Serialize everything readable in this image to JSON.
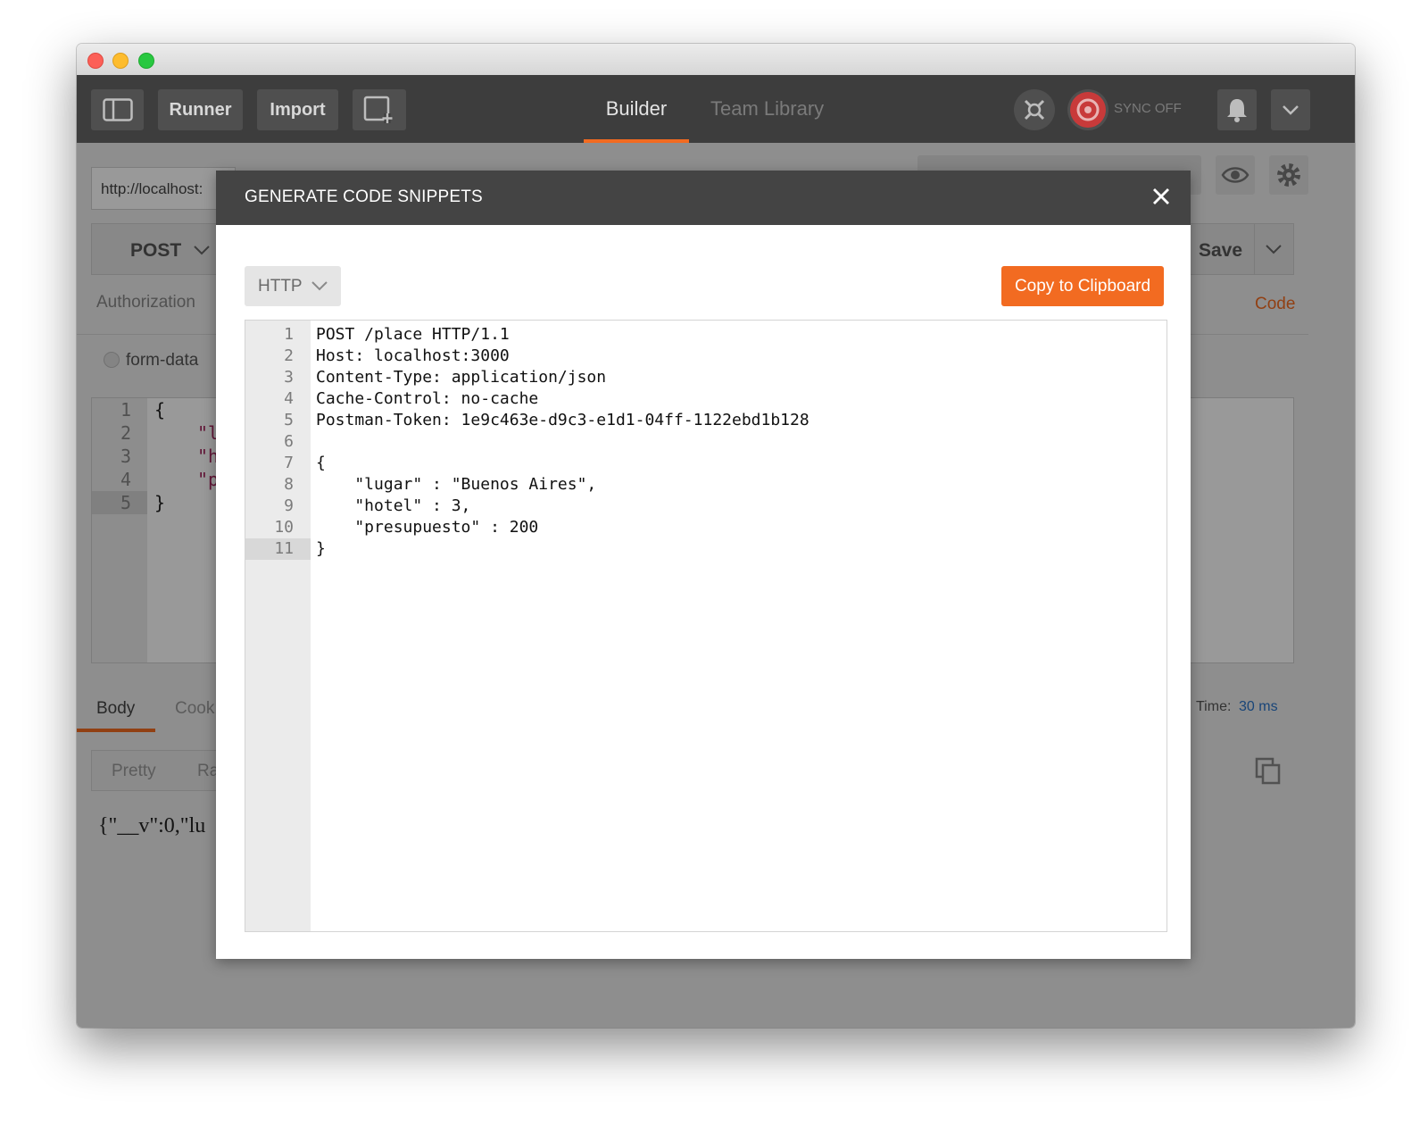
{
  "toolbar": {
    "runner_label": "Runner",
    "import_label": "Import",
    "tab_builder": "Builder",
    "tab_team_library": "Team Library",
    "sync_label": "SYNC OFF"
  },
  "request": {
    "url": "http://localhost:",
    "method": "POST",
    "save_label": "Save",
    "authorization_tab": "Authorization",
    "code_link": "Code",
    "body_option": "form-data"
  },
  "editor_bg": {
    "lines": [
      "1",
      "2",
      "3",
      "4",
      "5"
    ],
    "line1": "{",
    "line2": "\"l",
    "line3": "\"h",
    "line4": "\"p",
    "line5": "}"
  },
  "response": {
    "body_tab": "Body",
    "cookies_tab": "Cook",
    "time_label": "Time:",
    "time_value": "30 ms",
    "pretty_label": "Pretty",
    "raw_label": "Ra",
    "body_text": "{\"__v\":0,\"lu"
  },
  "modal": {
    "title": "GENERATE CODE SNIPPETS",
    "language": "HTTP",
    "copy_label": "Copy to Clipboard",
    "code_lines": [
      {
        "num": "1",
        "text": "POST /place HTTP/1.1"
      },
      {
        "num": "2",
        "text": "Host: localhost:3000"
      },
      {
        "num": "3",
        "text": "Content-Type: application/json"
      },
      {
        "num": "4",
        "text": "Cache-Control: no-cache"
      },
      {
        "num": "5",
        "text": "Postman-Token: 1e9c463e-d9c3-e1d1-04ff-1122ebd1b128"
      },
      {
        "num": "6",
        "text": ""
      },
      {
        "num": "7",
        "text": "{"
      },
      {
        "num": "8",
        "text": "    \"lugar\" : \"Buenos Aires\","
      },
      {
        "num": "9",
        "text": "    \"hotel\" : 3,"
      },
      {
        "num": "10",
        "text": "    \"presupuesto\" : 200"
      },
      {
        "num": "11",
        "text": "}"
      }
    ]
  },
  "colors": {
    "accent": "#f26b21",
    "toolbar_bg": "#3d3d3d",
    "modal_header_bg": "#444444",
    "sync_icon": "#c83a3a",
    "time_value": "#2a74c9"
  },
  "icons": [
    "sidebar-toggle-icon",
    "new-window-icon",
    "interceptor-icon",
    "sync-icon",
    "bell-icon",
    "chevron-down-icon",
    "close-icon",
    "eye-icon",
    "gear-icon",
    "copy-icon"
  ]
}
